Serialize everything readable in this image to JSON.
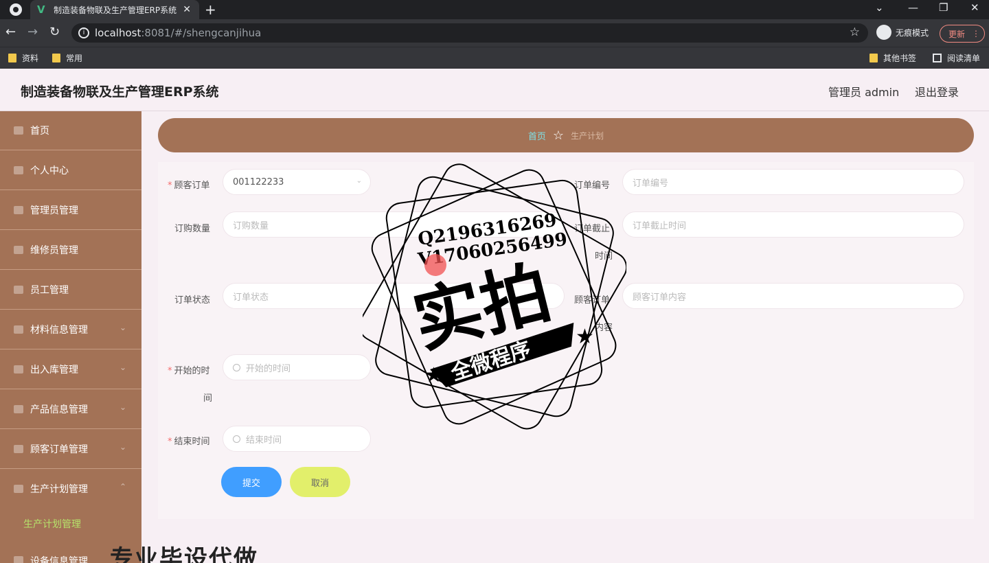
{
  "browser": {
    "tab_title": "制造装备物联及生产管理ERP系统",
    "url_host": "localhost",
    "url_path": ":8081/#/shengcanjihua",
    "incognito_label": "无痕模式",
    "update_label": "更新",
    "bookmarks": [
      "资料",
      "常用"
    ],
    "other_bookmarks": "其他书签",
    "reading_list": "阅读清单"
  },
  "header": {
    "title": "制造装备物联及生产管理ERP系统",
    "admin": "管理员 admin",
    "logout": "退出登录"
  },
  "sidebar": {
    "items": [
      {
        "label": "首页"
      },
      {
        "label": "个人中心"
      },
      {
        "label": "管理员管理"
      },
      {
        "label": "维修员管理"
      },
      {
        "label": "员工管理"
      },
      {
        "label": "材料信息管理"
      },
      {
        "label": "出入库管理"
      },
      {
        "label": "产品信息管理"
      },
      {
        "label": "顾客订单管理"
      },
      {
        "label": "生产计划管理"
      },
      {
        "label": "设备信息管理"
      }
    ],
    "active_sub": "生产计划管理"
  },
  "breadcrumb": {
    "home": "首页",
    "current": "生产计划"
  },
  "form": {
    "customer_order_label": "顾客订单",
    "customer_order_value": "001122233",
    "order_no_label": "订单编号",
    "order_no_placeholder": "订单编号",
    "qty_label": "订购数量",
    "qty_placeholder": "订购数量",
    "deadline_label_1": "订单截止",
    "deadline_label_2": "时间",
    "deadline_placeholder": "订单截止时间",
    "status_label": "订单状态",
    "status_placeholder": "订单状态",
    "content_label_1": "顾客订单",
    "content_label_2": "内容",
    "content_placeholder": "顾客订单内容",
    "start_label_1": "开始的时",
    "start_label_2": "间",
    "start_placeholder": "开始的时间",
    "end_label": "结束时间",
    "end_placeholder": "结束时间",
    "submit": "提交",
    "cancel": "取消"
  },
  "watermark": {
    "qq": "Q2196316269",
    "wechat": "V17060256499",
    "big": "实拍",
    "banner": "全微程序",
    "bottom": "专业毕设代做"
  },
  "colors": {
    "sidebar": "#a37256",
    "accent_blue": "#409eff",
    "cancel_yellow": "#e2ef6b",
    "active_green": "#b6e36b"
  }
}
